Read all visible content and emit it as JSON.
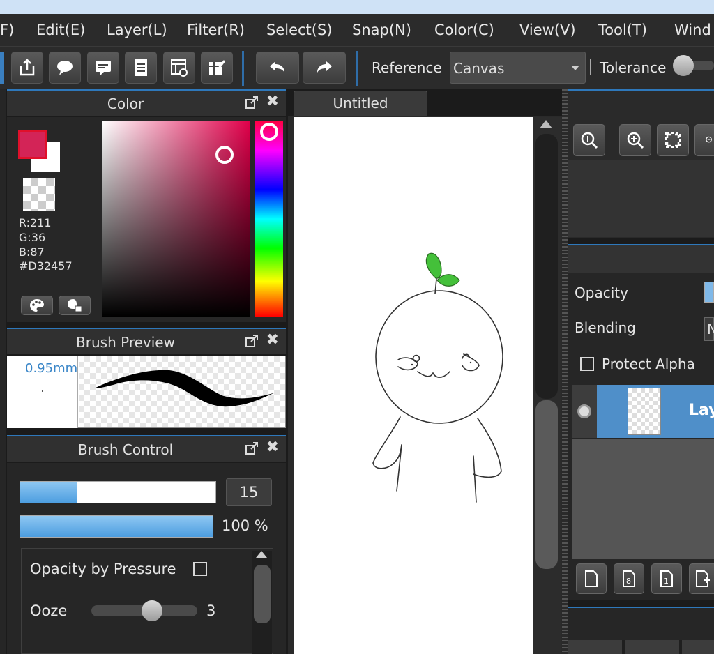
{
  "menu": [
    "F)",
    "Edit(E)",
    "Layer(L)",
    "Filter(R)",
    "Select(S)",
    "Snap(N)",
    "Color(C)",
    "View(V)",
    "Tool(T)",
    "Wind"
  ],
  "toolbar": {
    "reference_label": "Reference",
    "reference_value": "Canvas",
    "tolerance_label": "Tolerance"
  },
  "color_panel": {
    "title": "Color",
    "fg_color": "#D32457",
    "r": "R:211",
    "g": "G:36",
    "b": "B:87",
    "hex": "#D32457"
  },
  "brush_preview": {
    "title": "Brush Preview",
    "size": "0.95mm"
  },
  "brush_control": {
    "title": "Brush Control",
    "size_value": "15",
    "size_fraction": 0.29,
    "opacity_value": "100 %",
    "opacity_fraction": 1.0,
    "opacity_by_pressure": "Opacity by Pressure",
    "ooze_label": "Ooze",
    "ooze_value": "3"
  },
  "document": {
    "tab_title": "Untitled"
  },
  "layer_panel": {
    "opacity_label": "Opacity",
    "blending_label": "Blending",
    "blending_value": "N",
    "protect_alpha": "Protect Alpha",
    "layer_name": "Lay"
  },
  "colors": {
    "accent": "#2e78bb",
    "layer_selected": "#4f8fc9"
  }
}
